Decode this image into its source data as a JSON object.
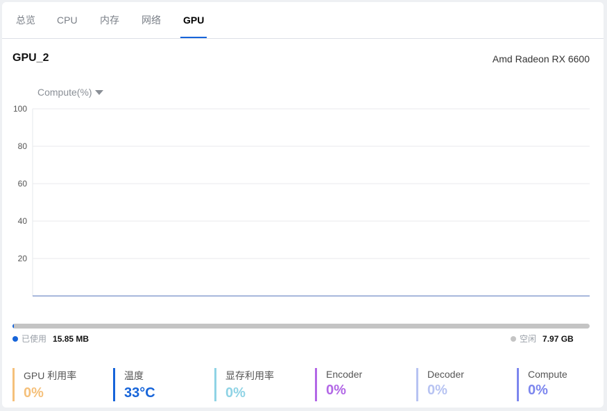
{
  "tabs": [
    {
      "label": "总览"
    },
    {
      "label": "CPU"
    },
    {
      "label": "内存"
    },
    {
      "label": "网络"
    },
    {
      "label": "GPU"
    }
  ],
  "active_tab": "GPU",
  "gpu": {
    "name": "GPU_2",
    "model": "Amd Radeon RX 6600"
  },
  "metric_select": {
    "value": "Compute(%)",
    "icon": "caret-down-icon"
  },
  "chart_data": {
    "type": "line",
    "y_ticks": [
      "100",
      "80",
      "60",
      "40",
      "20"
    ],
    "ylim": [
      0,
      100
    ],
    "series": [
      {
        "values": [
          0,
          0,
          0,
          0,
          0,
          0,
          0,
          0,
          0,
          0,
          0,
          0,
          0,
          0,
          0,
          0,
          0,
          0,
          0,
          0,
          0,
          0,
          0,
          0,
          0,
          0,
          0,
          0,
          0,
          0,
          0,
          0,
          0,
          0,
          0,
          0,
          0,
          0,
          0,
          0,
          0,
          0,
          0,
          0,
          0,
          0,
          0,
          0,
          0,
          0,
          0,
          0,
          0,
          0,
          0,
          0,
          0,
          0,
          0,
          0
        ],
        "color": "#8a9fd1"
      }
    ],
    "grid": true,
    "legend": "none"
  },
  "memory": {
    "used_label": "已使用",
    "used_value": "15.85 MB",
    "free_label": "空闲",
    "free_value": "7.97 GB",
    "used_fraction": 0.002,
    "used_color": "#1664d9",
    "free_color": "#c4c4c4"
  },
  "stats": [
    {
      "label": "GPU 利用率",
      "value": "0%",
      "color": "#f5c07a"
    },
    {
      "label": "温度",
      "value": "33°C",
      "color": "#1664d9"
    },
    {
      "label": "显存利用率",
      "value": "0%",
      "color": "#8fd3e5"
    },
    {
      "label": "Encoder",
      "value": "0%",
      "color": "#b267e6"
    },
    {
      "label": "Decoder",
      "value": "0%",
      "color": "#b7c3f2"
    },
    {
      "label": "Compute",
      "value": "0%",
      "color": "#7c86ee"
    }
  ]
}
